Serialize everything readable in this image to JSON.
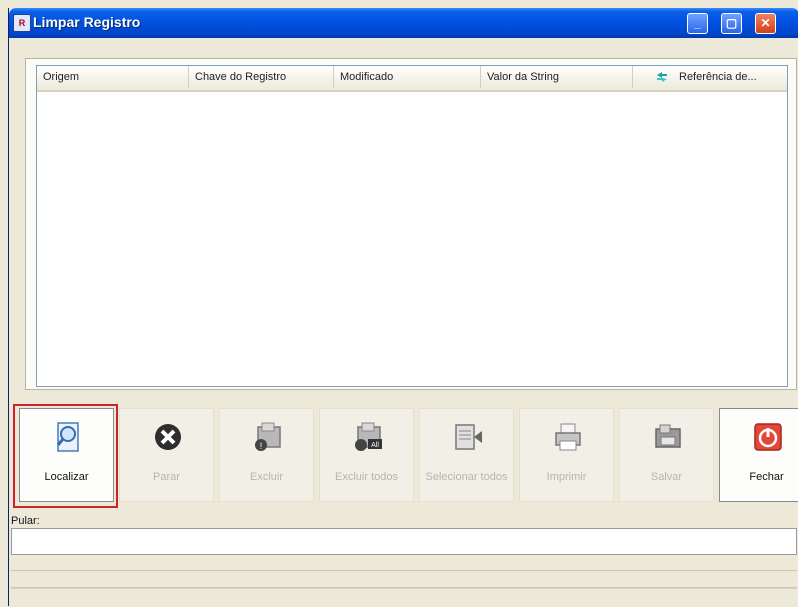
{
  "window": {
    "title": "Limpar Registro",
    "app_icon_text": "R"
  },
  "list": {
    "columns": [
      "Origem",
      "Chave do Registro",
      "Modificado",
      "Valor da String",
      "Referência de..."
    ],
    "rows": []
  },
  "toolbar": {
    "localizar": "Localizar",
    "parar": "Parar",
    "excluir": "Excluir",
    "excluir_todos": "Excluir todos",
    "selecionar_todos": "Selecionar todos",
    "imprimir": "Imprimir",
    "salvar": "Salvar",
    "fechar": "Fechar"
  },
  "pular": {
    "label": "Pular:",
    "value": ""
  },
  "icons": [
    "app-icon",
    "minimize-icon",
    "maximize-icon",
    "close-icon",
    "refresh-icon",
    "magnifier-document-icon",
    "stop-icon",
    "delete-icon",
    "delete-all-icon",
    "select-all-icon",
    "printer-icon",
    "save-icon",
    "power-icon"
  ]
}
